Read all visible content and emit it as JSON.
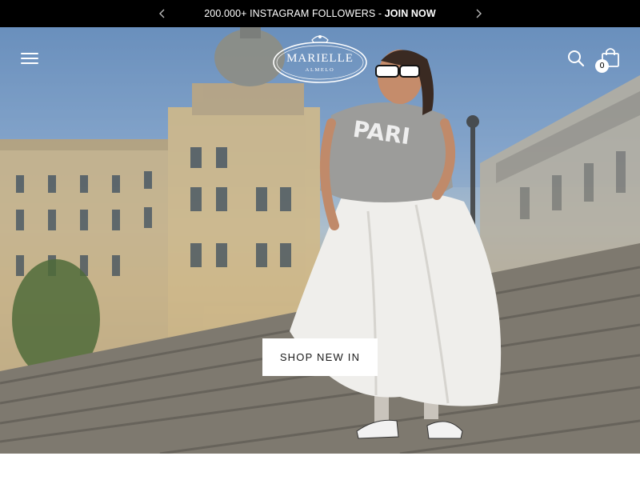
{
  "announcement": {
    "text": "200.000+ INSTAGRAM FOLLOWERS - ",
    "link": "JOIN NOW",
    "prev_icon": "chevron-left-icon",
    "next_icon": "chevron-right-icon"
  },
  "header": {
    "menu_icon": "hamburger-menu-icon",
    "logo": {
      "name": "MARIELLE",
      "subtitle": "ALMELO"
    },
    "search_icon": "search-icon",
    "cart_icon": "shopping-bag-icon",
    "cart_count": "0"
  },
  "hero": {
    "cta_label": "SHOP NEW IN"
  },
  "colors": {
    "announcement_bg": "#000000",
    "text_light": "#ffffff",
    "cta_bg": "#ffffff",
    "cta_text": "#1a1a1a"
  }
}
